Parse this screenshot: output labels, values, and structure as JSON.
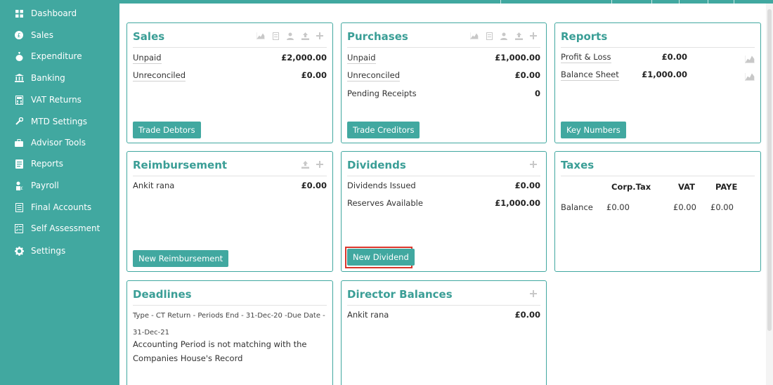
{
  "sidebar": {
    "items": [
      {
        "label": "Dashboard",
        "icon": "grid-icon"
      },
      {
        "label": "Sales",
        "icon": "pound-circle-icon"
      },
      {
        "label": "Expenditure",
        "icon": "money-bag-icon"
      },
      {
        "label": "Banking",
        "icon": "bank-icon"
      },
      {
        "label": "VAT Returns",
        "icon": "calculator-icon"
      },
      {
        "label": "MTD Settings",
        "icon": "tools-icon"
      },
      {
        "label": "Advisor Tools",
        "icon": "briefcase-icon"
      },
      {
        "label": "Reports",
        "icon": "report-icon"
      },
      {
        "label": "Payroll",
        "icon": "payroll-icon"
      },
      {
        "label": "Final Accounts",
        "icon": "ledger-icon"
      },
      {
        "label": "Self Assessment",
        "icon": "checklist-icon"
      },
      {
        "label": "Settings",
        "icon": "gear-icon"
      }
    ]
  },
  "sales": {
    "title": "Sales",
    "unpaid_label": "Unpaid",
    "unpaid_value": "£2,000.00",
    "unreconciled_label": "Unreconciled",
    "unreconciled_value": "£0.00",
    "button": "Trade Debtors"
  },
  "purchases": {
    "title": "Purchases",
    "unpaid_label": "Unpaid",
    "unpaid_value": "£1,000.00",
    "unreconciled_label": "Unreconciled",
    "unreconciled_value": "£0.00",
    "pending_label": "Pending Receipts",
    "pending_value": "0",
    "button": "Trade Creditors"
  },
  "reports": {
    "title": "Reports",
    "pl_label": "Profit & Loss",
    "pl_value": "£0.00",
    "bs_label": "Balance Sheet",
    "bs_value": "£1,000.00",
    "button": "Key Numbers"
  },
  "reimbursement": {
    "title": "Reimbursement",
    "name": "Ankit rana",
    "value": "£0.00",
    "button": "New Reimbursement"
  },
  "dividends": {
    "title": "Dividends",
    "issued_label": "Dividends Issued",
    "issued_value": "£0.00",
    "reserves_label": "Reserves Available",
    "reserves_value": "£1,000.00",
    "button": "New Dividend"
  },
  "taxes": {
    "title": "Taxes",
    "col_corp": "Corp.Tax",
    "col_vat": "VAT",
    "col_paye": "PAYE",
    "row_label": "Balance",
    "corp_value": "£0.00",
    "vat_value": "£0.00",
    "paye_value": "£0.00"
  },
  "deadlines": {
    "title": "Deadlines",
    "detail": "Type - CT Return - Periods End - 31-Dec-20 -Due Date - 31-Dec-21",
    "note": "Accounting Period is not matching with the Companies House's Record"
  },
  "director_balances": {
    "title": "Director Balances",
    "name": "Ankit rana",
    "value": "£0.00"
  },
  "colors": {
    "teal": "#41a8a0",
    "title_teal": "#3a9e96",
    "highlight_red": "#d9362b"
  }
}
